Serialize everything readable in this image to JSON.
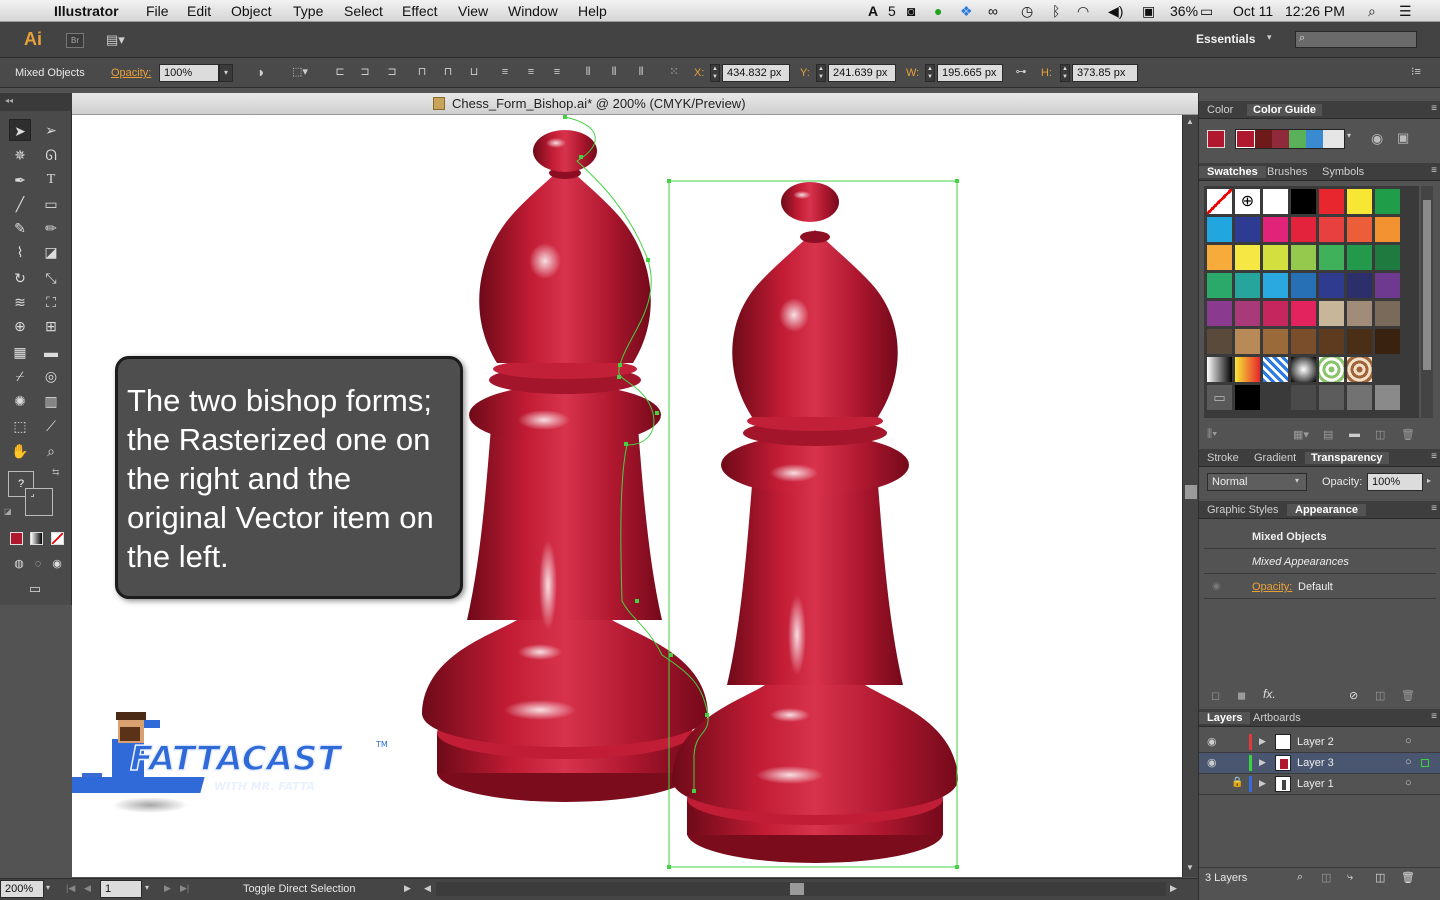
{
  "menubar": {
    "apple": "",
    "app": "Illustrator",
    "items": [
      "File",
      "Edit",
      "Object",
      "Type",
      "Select",
      "Effect",
      "View",
      "Window",
      "Help"
    ],
    "status": {
      "adobe_badge": "5",
      "battery": "36%",
      "date": "Oct 11",
      "time": "12:26 PM"
    }
  },
  "appbar": {
    "logo": "Ai",
    "bridge": "Br",
    "workspace": "Essentials",
    "search_placeholder": ""
  },
  "control": {
    "selection_label": "Mixed Objects",
    "opacity_label": "Opacity:",
    "opacity_value": "100%",
    "x_label": "X:",
    "x_value": "434.832 px",
    "y_label": "Y:",
    "y_value": "241.639 px",
    "w_label": "W:",
    "w_value": "195.665 px",
    "h_label": "H:",
    "h_value": "373.85 px"
  },
  "document": {
    "tab_title": "Chess_Form_Bishop.ai* @ 200% (CMYK/Preview)",
    "callout": [
      "The two bishop forms;",
      "the Rasterized one on",
      "the right and the",
      "original Vector item on",
      "the left."
    ],
    "logo_main": "FATTACAST",
    "logo_tm": "TM",
    "logo_sub": "WITH MR. FATTA"
  },
  "statusbar": {
    "zoom": "200%",
    "artboard": "1",
    "status_text": "Toggle Direct Selection"
  },
  "panels": {
    "color_tabs": [
      "Color",
      "Color Guide"
    ],
    "swatch_tabs": [
      "Swatches",
      "Brushes",
      "Symbols"
    ],
    "swatch_colors": [
      "#ffffff",
      "#ffffff",
      "#ffffff",
      "#000000",
      "#e8262d",
      "#f7e634",
      "#1f9d48",
      "#22a6e0",
      "#2e3b93",
      "#e2237a",
      "#e2233b",
      "#e8403e",
      "#ec5d3a",
      "#f39230",
      "#f6ab3a",
      "#f6e844",
      "#d3df3e",
      "#94c94e",
      "#3fb15b",
      "#239a4b",
      "#1e7a3e",
      "#2ba96b",
      "#26a59c",
      "#29a9df",
      "#2770b6",
      "#2f3b8f",
      "#2d2f6b",
      "#6e3a8f",
      "#8b3b8f",
      "#a93a7a",
      "#c6265e",
      "#e2235e",
      "#c8b69a",
      "#a08c78",
      "#7a6a5a",
      "#5a4a3c",
      "#b88a58",
      "#9a6a3a",
      "#7a4e2a",
      "#5e3a1e",
      "#4a2e16",
      "#3a2210"
    ],
    "stroke_tabs": [
      "Stroke",
      "Gradient",
      "Transparency"
    ],
    "blend_mode": "Normal",
    "opacity_label": "Opacity:",
    "opacity_value": "100%",
    "appearance_tabs": [
      "Graphic Styles",
      "Appearance"
    ],
    "appearance_title": "Mixed Objects",
    "appearance_sub": "Mixed Appearances",
    "appearance_opacity_label": "Opacity:",
    "appearance_opacity_value": "Default",
    "layers_tabs": [
      "Layers",
      "Artboards"
    ],
    "layers": [
      {
        "name": "Layer 2",
        "color": "#e23a3a"
      },
      {
        "name": "Layer 3",
        "color": "#3ad13a"
      },
      {
        "name": "Layer 1",
        "color": "#3a6ae2"
      }
    ],
    "layers_count": "3 Layers"
  },
  "colors": {
    "bishop_red": "#b01830",
    "selection_green": "#44d244",
    "opacity_label_orange": "#e8a13a"
  }
}
